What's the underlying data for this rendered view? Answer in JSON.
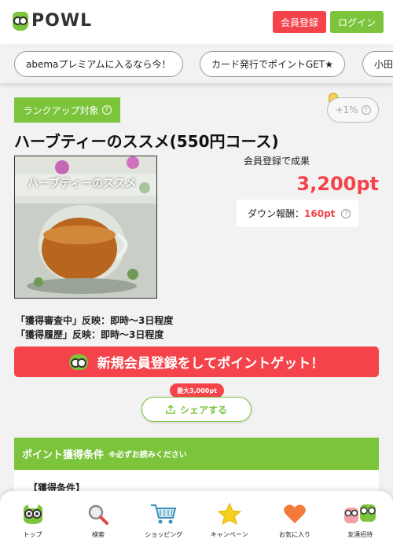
{
  "header": {
    "logo_text": "POWL",
    "register_label": "会員登録",
    "login_label": "ログイン"
  },
  "promo": {
    "chips": [
      "abemaプレミアムに入るなら今！",
      "カード発行でポイントGET★",
      "小田"
    ]
  },
  "offer": {
    "rankup_label": "ランクアップ対象",
    "rate_label": "+1%",
    "title": "ハーブティーのススメ(550円コース)",
    "image_caption": "ハーブティーのススメ",
    "reward_label": "会員登録で成果",
    "reward_value": "3,200pt",
    "down_label": "ダウン報酬：",
    "down_value": "160pt",
    "info_line1": "「獲得審査中」反映：即時～3日程度",
    "info_line2": "「獲得履歴」反映：即時～3日程度",
    "cta_label": "新規会員登録をしてポイントゲット！",
    "max_badge": "最大3,000pt",
    "share_label": "シェアする"
  },
  "conditions": {
    "header": "ポイント獲得条件",
    "header_note": "※必ずお読みください",
    "label": "【獲得条件】"
  },
  "tabbar": {
    "items": [
      {
        "label": "トップ",
        "icon": "owl-icon"
      },
      {
        "label": "検索",
        "icon": "search-icon"
      },
      {
        "label": "ショッピング",
        "icon": "cart-icon"
      },
      {
        "label": "キャンペーン",
        "icon": "star-icon"
      },
      {
        "label": "お気に入り",
        "icon": "heart-icon"
      },
      {
        "label": "友達招待",
        "icon": "friends-icon"
      }
    ]
  },
  "colors": {
    "accent_red": "#f5434b",
    "accent_green": "#7cc43c"
  }
}
